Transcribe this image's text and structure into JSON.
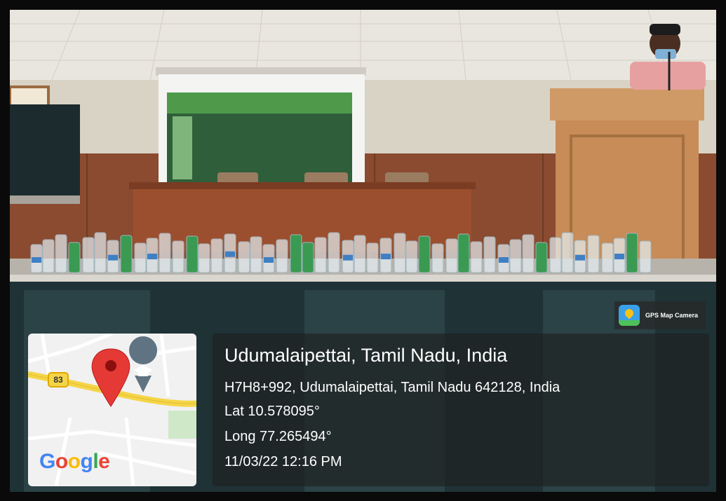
{
  "badge": {
    "app_name": "GPS Map Camera",
    "icon": "gps-map-camera-icon"
  },
  "map": {
    "route_number": "83",
    "logo": "Google",
    "marker_icon": "map-pin-icon",
    "poi_icon": "graduation-cap-icon"
  },
  "location": {
    "place": "Udumalaipettai, Tamil Nadu, India",
    "address": "H7H8+992, Udumalaipettai, Tamil Nadu 642128, India",
    "latitude": "Lat 10.578095°",
    "longitude": "Long 77.265494°",
    "datetime": "11/03/22 12:16 PM"
  },
  "colors": {
    "pin": "#e53935",
    "poi": "#5f7382",
    "road": "#f5d548",
    "panel": "#1e1e1e"
  }
}
